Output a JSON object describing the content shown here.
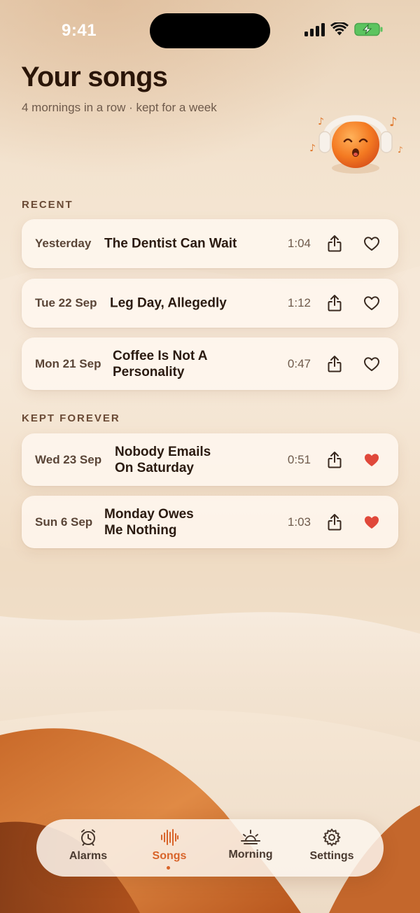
{
  "status_bar": {
    "time": "9:41",
    "icons": [
      "cellular-signal-icon",
      "wifi-icon",
      "battery-charging-icon"
    ],
    "battery_color": "#58c25a"
  },
  "header": {
    "title": "Your songs",
    "subtitle": "4 mornings in a row · kept for a week",
    "mascot": "singing-sun-with-headphones"
  },
  "sections": {
    "recent": {
      "label": "RECENT",
      "items": [
        {
          "date": "Yesterday",
          "title": "The Dentist Can Wait",
          "duration": "1:04",
          "favorited": false
        },
        {
          "date": "Tue 22 Sep",
          "title": "Leg Day, Allegedly",
          "duration": "1:12",
          "favorited": false
        },
        {
          "date": "Mon 21 Sep",
          "title_line1": "Coffee Is Not A",
          "title_line2": "Personality",
          "duration": "0:47",
          "favorited": false
        }
      ]
    },
    "kept": {
      "label": "KEPT FOREVER",
      "items": [
        {
          "date": "Wed 23 Sep",
          "title_line1": "Nobody Emails",
          "title_line2": "On Saturday",
          "duration": "0:51",
          "favorited": true
        },
        {
          "date": "Sun 6 Sep",
          "title_line1": "Monday Owes",
          "title_line2": "Me Nothing",
          "duration": "1:03",
          "favorited": true
        }
      ]
    }
  },
  "tabbar": {
    "tabs": [
      {
        "label": "Alarms",
        "icon": "alarm-clock-icon"
      },
      {
        "label": "Songs",
        "icon": "waveform-icon",
        "active": true
      },
      {
        "label": "Morning",
        "icon": "sunrise-icon"
      },
      {
        "label": "Settings",
        "icon": "gear-icon"
      }
    ]
  },
  "colors": {
    "accent": "#d8642a",
    "heart_filled": "#e0483a",
    "text_dark": "#2a1a10"
  }
}
